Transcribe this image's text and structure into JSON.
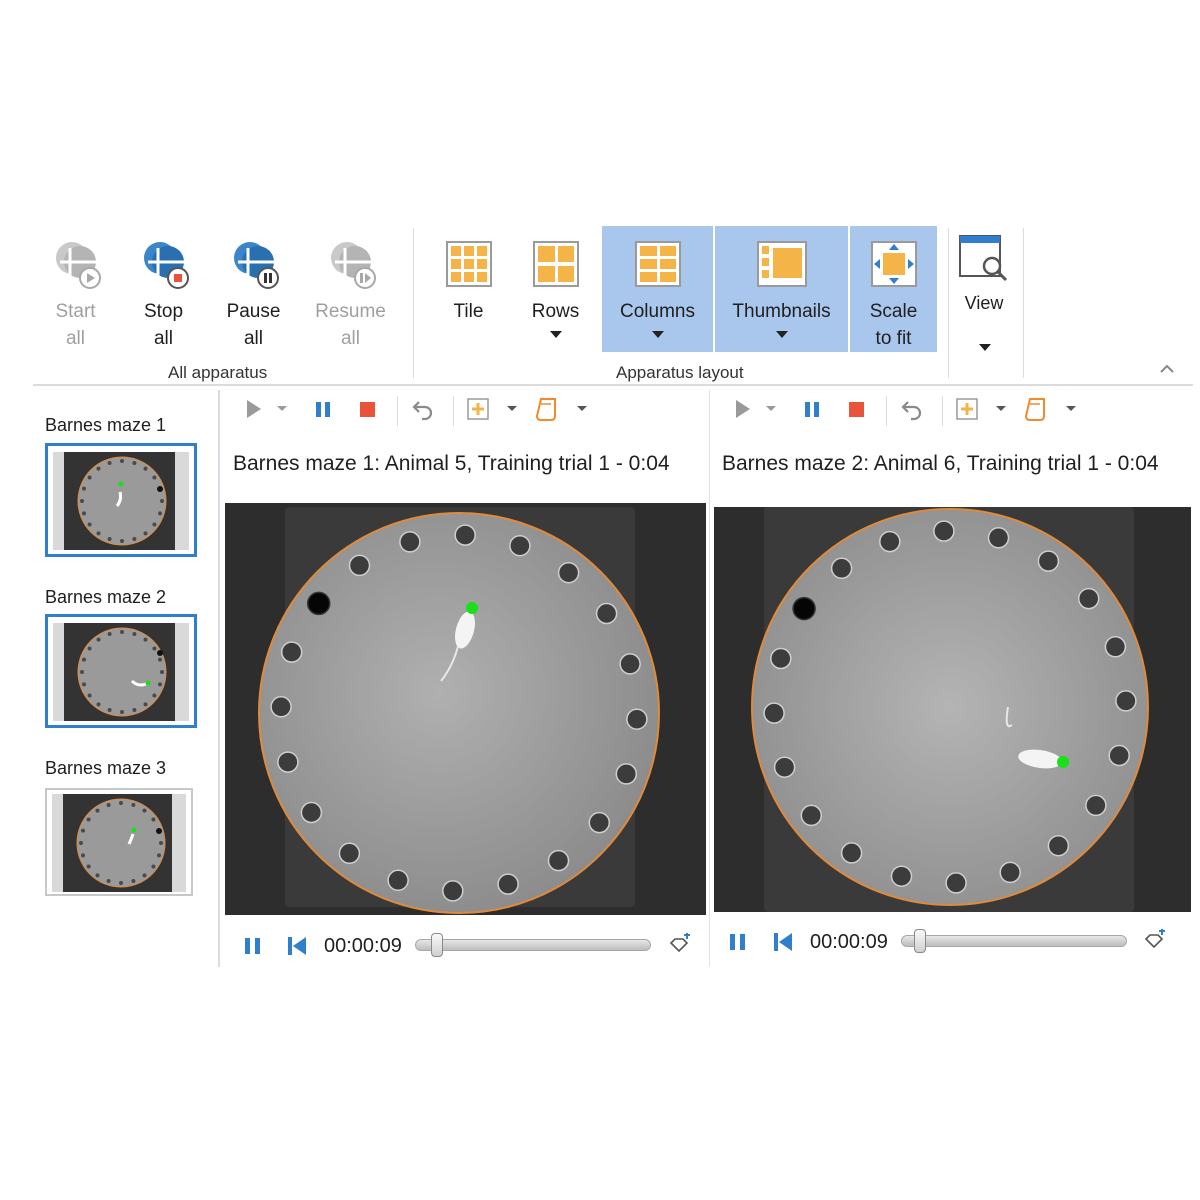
{
  "ribbon": {
    "start_all": {
      "line1": "Start",
      "line2": "all"
    },
    "stop_all": {
      "line1": "Stop",
      "line2": "all"
    },
    "pause_all": {
      "line1": "Pause",
      "line2": "all"
    },
    "resume_all": {
      "line1": "Resume",
      "line2": "all"
    },
    "group_all_apparatus": "All apparatus",
    "tile": "Tile",
    "rows": "Rows",
    "columns": "Columns",
    "thumbnails": "Thumbnails",
    "scale_to_fit": {
      "line1": "Scale",
      "line2": "to fit"
    },
    "view": "View",
    "group_apparatus_layout": "Apparatus layout"
  },
  "thumbnails": [
    {
      "title": "Barnes maze 1",
      "selected": true
    },
    {
      "title": "Barnes maze 2",
      "selected": true
    },
    {
      "title": "Barnes maze 3",
      "selected": false
    }
  ],
  "panels": [
    {
      "title": "Barnes maze 1: Animal 5, Training trial 1 - 0:04",
      "time": "00:00:09"
    },
    {
      "title": "Barnes maze 2: Animal 6, Training trial 1 - 0:04",
      "time": "00:00:09"
    }
  ],
  "colors": {
    "accent": "#2f7fcd",
    "ribbon_active": "#a9c6ec",
    "stop": "#e8533a",
    "maze_outline": "#e08a3c",
    "tracking_dot": "#19e019"
  }
}
